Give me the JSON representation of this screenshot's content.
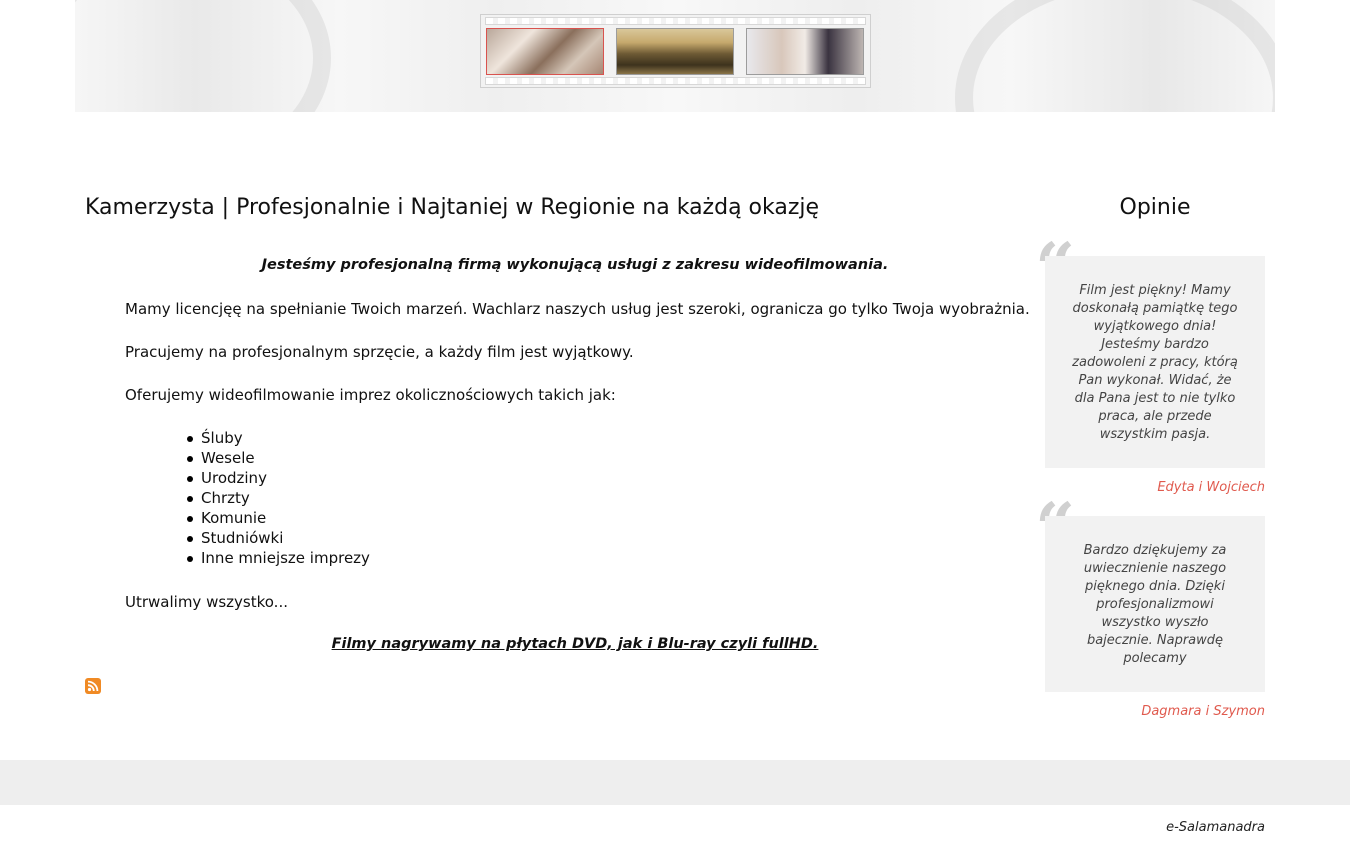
{
  "header": {
    "filmstrip_frames": [
      "wedding-rings-photo",
      "bridal-party-photo",
      "couple-portrait-photo"
    ]
  },
  "main": {
    "title": "Kamerzysta | Profesjonalnie i Najtaniej w Regionie na każdą okazję",
    "lead": "Jesteśmy profesjonalną firmą wykonującą usługi z zakresu wideofilmowania.",
    "paragraphs": [
      "Mamy licencjęę na spełnianie Twoich marzeń. Wachlarz naszych usług jest szeroki, ogranicza go tylko Twoja wyobrażnia.",
      "Pracujemy na profesjonalnym sprzęcie, a każdy film jest wyjątkowy.",
      "Oferujemy wideofilmowanie imprez okolicznościowych takich jak:",
      "Utrwalimy wszystko..."
    ],
    "events": [
      "Śluby",
      "Wesele",
      "Urodziny",
      "Chrzty",
      "Komunie",
      "Studniówki",
      "Inne mniejsze imprezy"
    ],
    "closing_link": "Filmy nagrywamy na płytach DVD, jak i Blu-ray czyli fullHD.",
    "rss_icon": "rss-icon"
  },
  "sidebar": {
    "title": "Opinie",
    "testimonials": [
      {
        "text": "Film jest piękny! Mamy doskonałą pamiątkę tego wyjątkowego dnia! Jesteśmy bardzo zadowoleni z pracy, którą Pan wykonał. Widać, że dla Pana jest to nie tylko praca, ale przede wszystkim pasja.",
        "author": "Edyta i Wojciech"
      },
      {
        "text": "Bardzo dziękujemy za uwiecznienie naszego pięknego dnia. Dzięki profesjonalizmowi wszystko wyszło bajecznie. Naprawdę polecamy",
        "author": "Dagmara i Szymon"
      }
    ],
    "quote_glyph": "“"
  },
  "footer": {
    "credit": "e-Salamanadra"
  },
  "colors": {
    "author": "#e05a4e",
    "quote_bg": "#f2f2f2",
    "footer_band": "#eeeeee",
    "rss": "#f08a24"
  }
}
